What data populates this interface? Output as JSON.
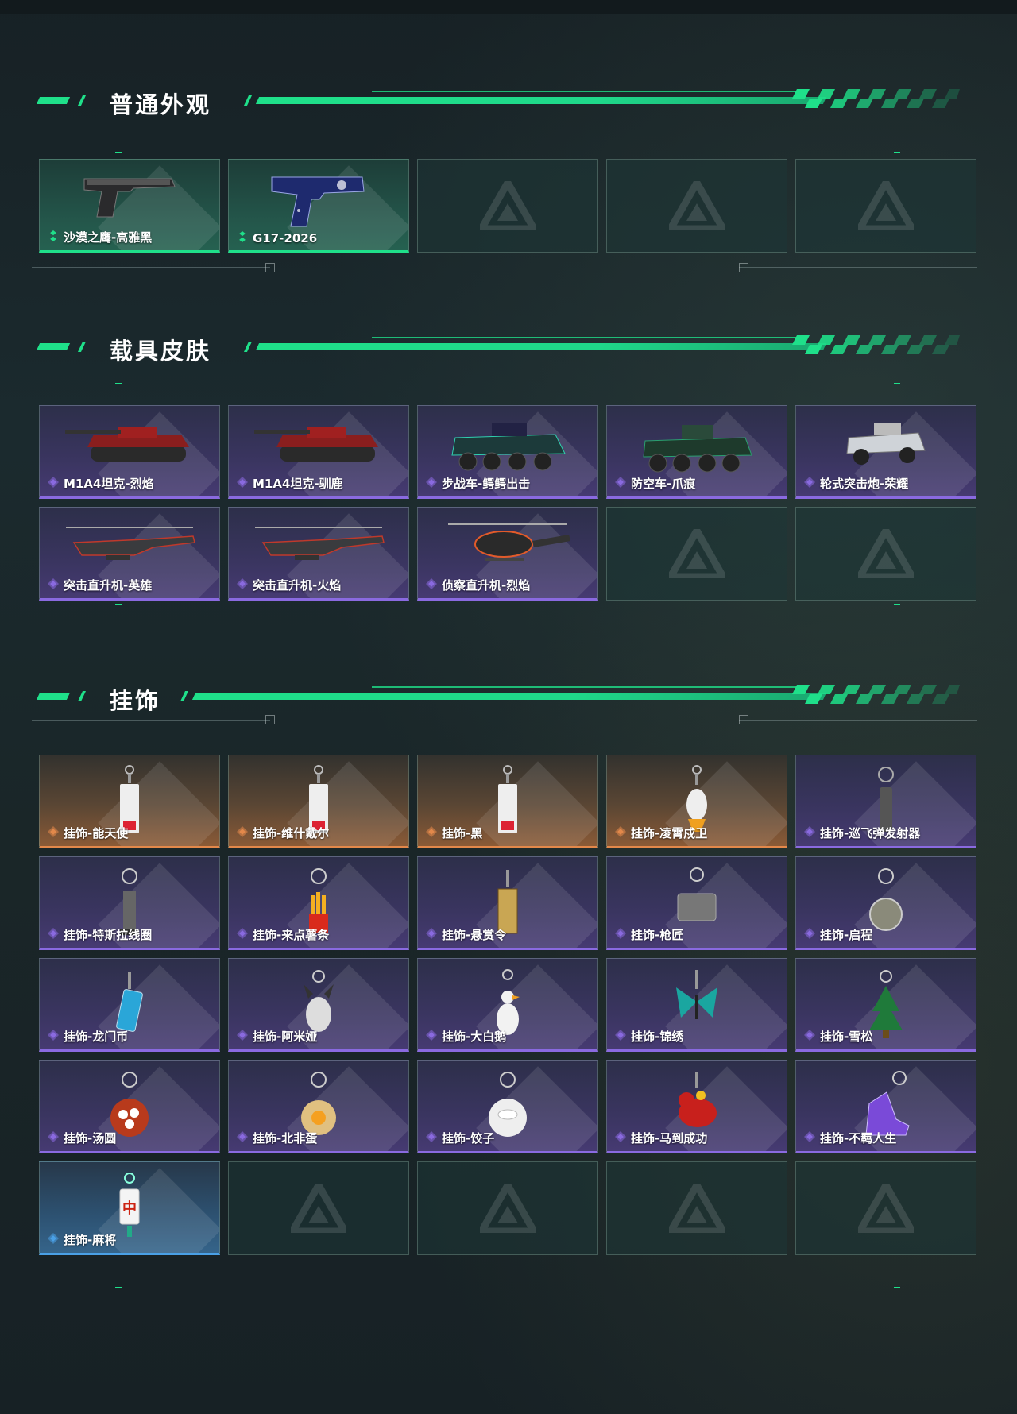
{
  "colors": {
    "accent": "#1fe08a",
    "green_rarity": "#1fe08a",
    "purple_rarity": "#8a6ae0",
    "orange_rarity": "#e3884a",
    "blue_rarity": "#4aa0e6"
  },
  "sections": [
    {
      "title": "普通外观",
      "items": [
        {
          "label": "沙漠之鹰-高雅黑",
          "rarity": "green",
          "icon": "pistol-desert-eagle-icon"
        },
        {
          "label": "G17-2026",
          "rarity": "green",
          "icon": "pistol-g17-icon"
        },
        {
          "label": "",
          "rarity": "empty"
        },
        {
          "label": "",
          "rarity": "empty"
        },
        {
          "label": "",
          "rarity": "empty"
        }
      ]
    },
    {
      "title": "载具皮肤",
      "items": [
        {
          "label": "M1A4坦克-烈焰",
          "rarity": "purple",
          "icon": "tank-icon"
        },
        {
          "label": "M1A4坦克-驯鹿",
          "rarity": "purple",
          "icon": "tank-icon"
        },
        {
          "label": "步战车-鳄鳄出击",
          "rarity": "purple",
          "icon": "ifv-icon"
        },
        {
          "label": "防空车-爪痕",
          "rarity": "purple",
          "icon": "aa-vehicle-icon"
        },
        {
          "label": "轮式突击炮-荣耀",
          "rarity": "purple",
          "icon": "wheeled-gun-icon"
        },
        {
          "label": "突击直升机-英雄",
          "rarity": "purple",
          "icon": "attack-helicopter-icon"
        },
        {
          "label": "突击直升机-火焰",
          "rarity": "purple",
          "icon": "attack-helicopter-icon"
        },
        {
          "label": "侦察直升机-烈焰",
          "rarity": "purple",
          "icon": "scout-helicopter-icon"
        },
        {
          "label": "",
          "rarity": "empty"
        },
        {
          "label": "",
          "rarity": "empty"
        }
      ]
    },
    {
      "title": "挂饰",
      "items": [
        {
          "label": "挂饰-能天使",
          "rarity": "orange",
          "icon": "charm-tag-icon"
        },
        {
          "label": "挂饰-维什戴尔",
          "rarity": "orange",
          "icon": "charm-tag-icon"
        },
        {
          "label": "挂饰-黑",
          "rarity": "orange",
          "icon": "charm-tag-icon"
        },
        {
          "label": "挂饰-凌霄戍卫",
          "rarity": "orange",
          "icon": "charm-figure-icon"
        },
        {
          "label": "挂饰-巡飞弹发射器",
          "rarity": "purple",
          "icon": "charm-launcher-icon"
        },
        {
          "label": "挂饰-特斯拉线圈",
          "rarity": "purple",
          "icon": "charm-coil-icon"
        },
        {
          "label": "挂饰-来点薯条",
          "rarity": "purple",
          "icon": "charm-fries-icon"
        },
        {
          "label": "挂饰-悬赏令",
          "rarity": "purple",
          "icon": "charm-scroll-icon"
        },
        {
          "label": "挂饰-枪匠",
          "rarity": "purple",
          "icon": "charm-dogtag-icon"
        },
        {
          "label": "挂饰-启程",
          "rarity": "purple",
          "icon": "charm-medal-icon"
        },
        {
          "label": "挂饰-龙门币",
          "rarity": "purple",
          "icon": "charm-card-icon"
        },
        {
          "label": "挂饰-阿米娅",
          "rarity": "purple",
          "icon": "charm-bunny-icon"
        },
        {
          "label": "挂饰-大白鹅",
          "rarity": "purple",
          "icon": "charm-goose-icon"
        },
        {
          "label": "挂饰-锦绣",
          "rarity": "purple",
          "icon": "charm-butterfly-icon"
        },
        {
          "label": "挂饰-雪松",
          "rarity": "purple",
          "icon": "charm-tree-icon"
        },
        {
          "label": "挂饰-汤圆",
          "rarity": "purple",
          "icon": "charm-bowl-icon"
        },
        {
          "label": "挂饰-北非蛋",
          "rarity": "purple",
          "icon": "charm-pan-icon"
        },
        {
          "label": "挂饰-饺子",
          "rarity": "purple",
          "icon": "charm-plate-icon"
        },
        {
          "label": "挂饰-马到成功",
          "rarity": "purple",
          "icon": "charm-horse-icon"
        },
        {
          "label": "挂饰-不羁人生",
          "rarity": "purple",
          "icon": "charm-shoe-icon"
        },
        {
          "label": "挂饰-麻将",
          "rarity": "blue",
          "icon": "charm-mahjong-icon"
        },
        {
          "label": "",
          "rarity": "empty"
        },
        {
          "label": "",
          "rarity": "empty"
        },
        {
          "label": "",
          "rarity": "empty"
        },
        {
          "label": "",
          "rarity": "empty"
        }
      ]
    }
  ]
}
